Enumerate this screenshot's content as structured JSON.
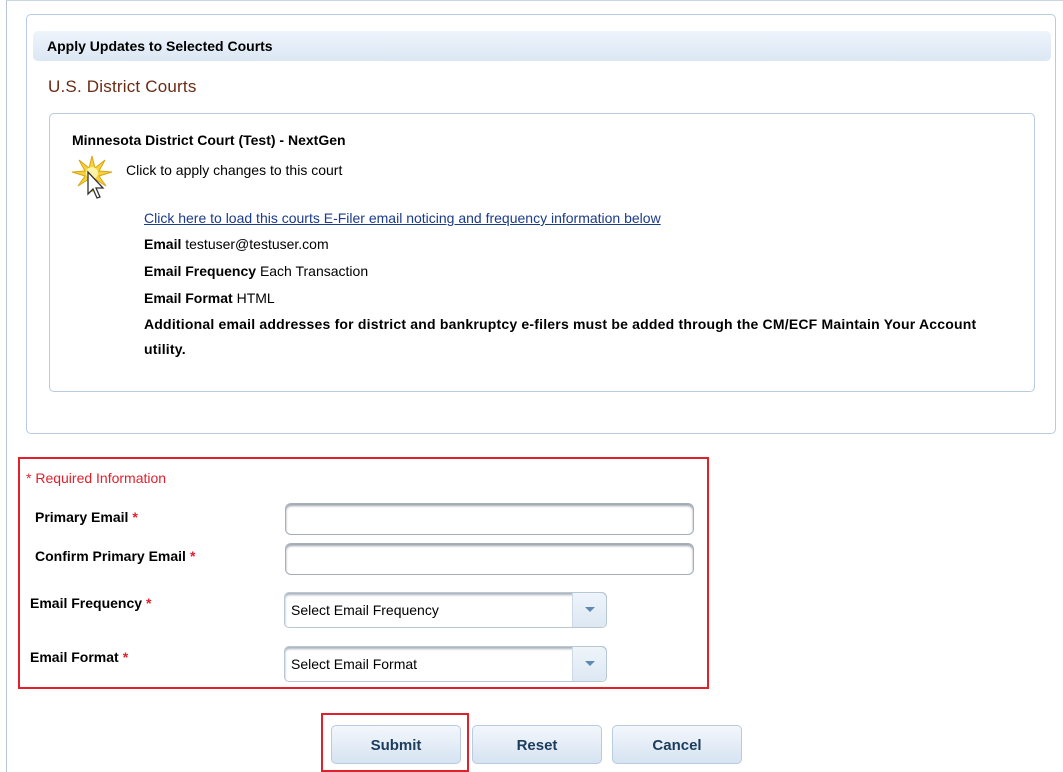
{
  "panel": {
    "header": "Apply Updates to Selected Courts",
    "section_title": "U.S. District Courts",
    "court": {
      "name": "Minnesota District Court (Test) - NextGen",
      "apply_text": "Click to apply changes to this court",
      "load_link": "Click here to load this courts E-Filer email noticing and frequency information below",
      "email_label": "Email",
      "email_value": "testuser@testuser.com",
      "frequency_label": "Email Frequency",
      "frequency_value": "Each Transaction",
      "format_label": "Email Format",
      "format_value": "HTML",
      "note": "Additional email addresses for district and bankruptcy e-filers must be added through the CM/ECF Maintain Your Account utility."
    }
  },
  "form": {
    "required_info": "* Required Information",
    "star": "*",
    "primary_email_label": "Primary Email",
    "primary_email_value": "",
    "confirm_email_label": "Confirm Primary Email",
    "confirm_email_value": "",
    "frequency_label": "Email Frequency",
    "frequency_selected": "Select Email Frequency",
    "format_label": "Email Format",
    "format_selected": "Select Email Format"
  },
  "buttons": {
    "submit": "Submit",
    "reset": "Reset",
    "cancel": "Cancel"
  },
  "colors": {
    "highlight": "#e2202c",
    "section_title": "#6b2a14",
    "link": "#1a3a8a"
  },
  "icons": [
    "sparkle-cursor-icon",
    "chevron-down-icon"
  ]
}
